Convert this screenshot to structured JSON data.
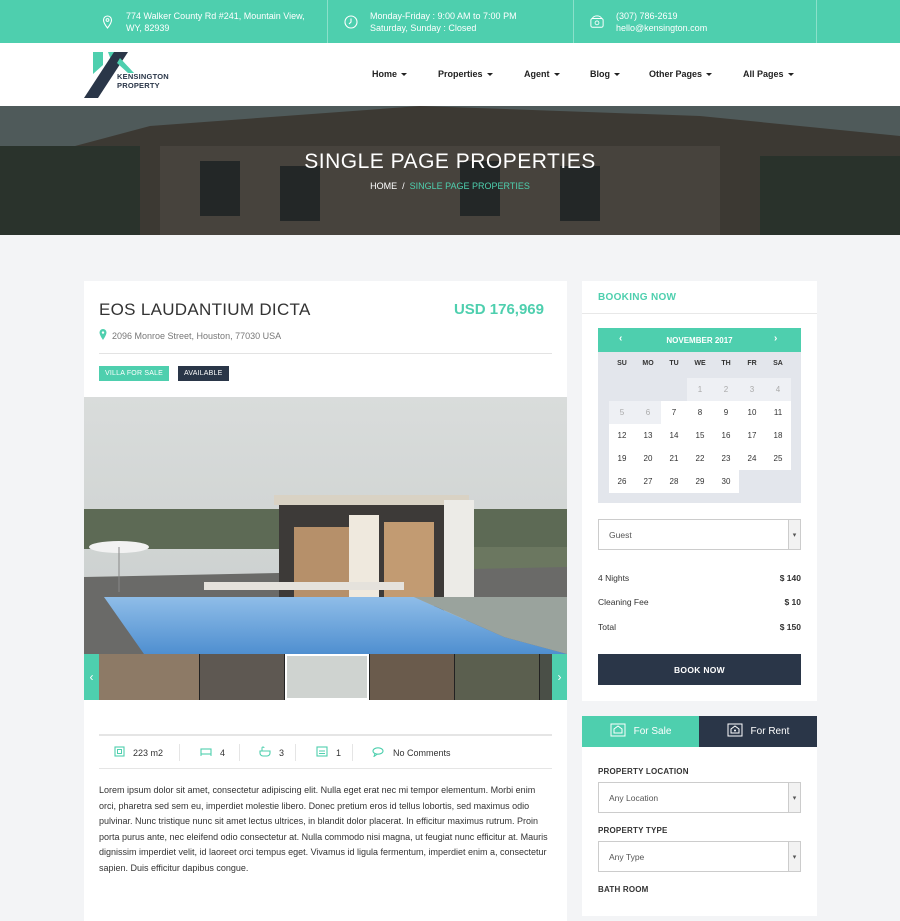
{
  "topbar": {
    "address_line1": "774 Walker County Rd #241, Mountain View,",
    "address_line2": "WY, 82939",
    "hours_line1": "Monday-Friday : 9:00 AM to 7:00 PM",
    "hours_line2": "Saturday, Sunday : Closed",
    "phone": "(307) 786-2619",
    "email": "hello@kensington.com",
    "icons": [
      "map-pin-icon",
      "clock-icon",
      "phone-icon"
    ]
  },
  "logo": {
    "line1": "KENSINGTON",
    "line2": "PROPERTY"
  },
  "menu": [
    "Home",
    "Properties",
    "Agent",
    "Blog",
    "Other Pages",
    "All Pages"
  ],
  "hero": {
    "title": "SINGLE PAGE PROPERTIES",
    "crumb_home": "HOME",
    "crumb_sep": "/",
    "crumb_current": "SINGLE PAGE PROPERTIES"
  },
  "property": {
    "title": "EOS LAUDANTIUM DICTA",
    "price": "USD 176,969",
    "address": "2096 Monroe Street, Houston, 77030 USA",
    "badges": [
      "VILLA FOR SALE",
      "AVAILABLE"
    ],
    "features": {
      "area": "223 m2",
      "beds": "4",
      "baths": "3",
      "garage": "1",
      "comments": "No Comments"
    },
    "description": "Lorem ipsum dolor sit amet, consectetur adipiscing elit. Nulla eget erat nec mi tempor elementum. Morbi enim orci, pharetra sed sem eu, imperdiet molestie libero. Donec pretium eros id tellus lobortis, sed maximus odio pulvinar. Nunc tristique nunc sit amet lectus ultrices, in blandit dolor placerat. In efficitur maximus rutrum. Proin porta purus ante, nec eleifend odio consectetur at. Nulla commodo nisi magna, ut feugiat nunc efficitur at. Mauris dignissim imperdiet velit, id laoreet orci tempus eget. Vivamus id ligula fermentum, imperdiet enim a, consectetur sapien. Duis efficitur dapibus congue."
  },
  "booking": {
    "title": "BOOKING NOW",
    "calendar": {
      "month": "NOVEMBER 2017",
      "prev": "‹",
      "next": "›",
      "weekdays": [
        "SU",
        "MO",
        "TU",
        "WE",
        "TH",
        "FR",
        "SA"
      ],
      "disabled_days": [
        "1",
        "2",
        "3",
        "4",
        "5",
        "6"
      ],
      "days": [
        "7",
        "8",
        "9",
        "10",
        "11",
        "12",
        "13",
        "14",
        "15",
        "16",
        "17",
        "18",
        "19",
        "20",
        "21",
        "22",
        "23",
        "24",
        "25",
        "26",
        "27",
        "28",
        "29",
        "30"
      ]
    },
    "guest_select": "Guest",
    "rows": [
      {
        "label": "4 Nights",
        "value": "$ 140"
      },
      {
        "label": "Cleaning Fee",
        "value": "$ 10"
      },
      {
        "label": "Total",
        "value": "$ 150"
      }
    ],
    "book_button": "BOOK NOW"
  },
  "search": {
    "tab_sale": "For Sale",
    "tab_rent": "For Rent",
    "location_label": "PROPERTY LOCATION",
    "location_value": "Any Location",
    "type_label": "PROPERTY TYPE",
    "type_value": "Any Type",
    "bath_label": "BATH ROOM"
  },
  "colors": {
    "accent": "#4ecfae",
    "dark": "#2a3648"
  }
}
